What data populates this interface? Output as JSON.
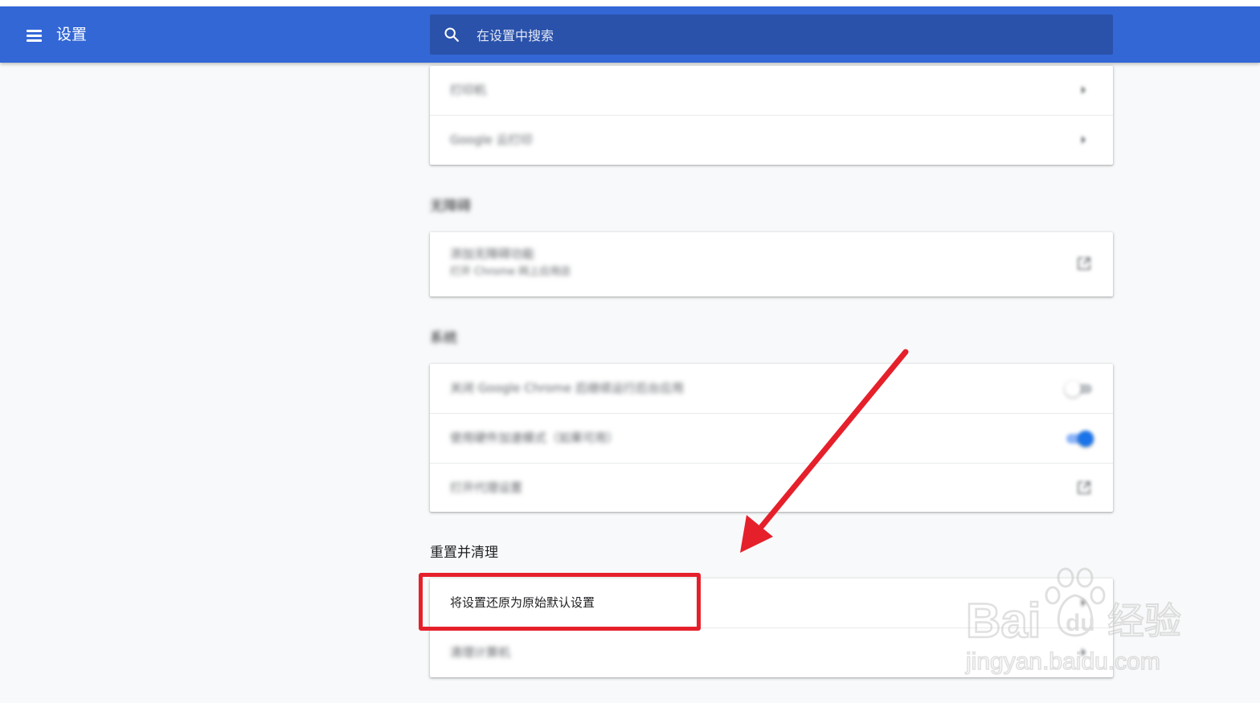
{
  "app": {
    "title": "设置"
  },
  "search": {
    "placeholder": "在设置中搜索"
  },
  "cards": {
    "top": {
      "rows": [
        {
          "label": "打印机"
        },
        {
          "label": "Google 云打印"
        }
      ]
    },
    "accessibility": {
      "section_title": "无障碍",
      "rows": [
        {
          "label": "添加无障碍功能",
          "sublabel": "打开 Chrome 网上应用店"
        }
      ]
    },
    "system": {
      "section_title": "系统",
      "rows": [
        {
          "label": "关闭 Google Chrome 后继续运行后台应用",
          "toggle": false
        },
        {
          "label": "使用硬件加速模式（如果可用）",
          "toggle": true
        },
        {
          "label": "打开代理设置"
        }
      ]
    },
    "reset": {
      "section_title": "重置并清理",
      "rows": [
        {
          "label": "将设置还原为原始默认设置"
        },
        {
          "label": "清理计算机"
        }
      ]
    }
  },
  "watermark": {
    "brand": "Bai",
    "brand_suffix": "du",
    "cn": "经验",
    "url": "jingyan.baidu.com"
  },
  "colors": {
    "toolbar": "#3367d6",
    "search_bg": "#2a52ab",
    "highlight": "#e5202b",
    "toggle_on": "#1a73e8"
  },
  "icons": [
    "menu-icon",
    "search-icon",
    "chevron-right-icon",
    "open-external-icon"
  ]
}
